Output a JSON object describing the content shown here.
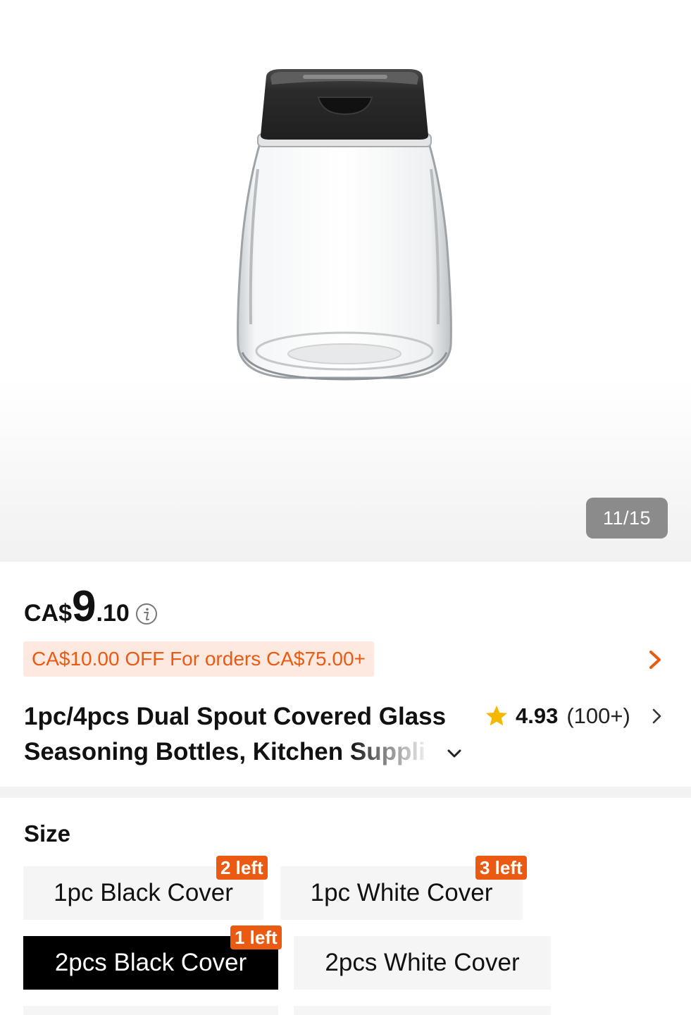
{
  "gallery": {
    "image_counter": "11/15",
    "product_image": "glass-seasoning-bottle-black-cover"
  },
  "price": {
    "currency": "CA$",
    "integer": "9",
    "decimal": ".10",
    "info_icon": "info-icon"
  },
  "promo": {
    "text": "CA$10.00 OFF For orders CA$75.00+",
    "arrow_icon": "chevron-right-icon",
    "color": "#ea5a13",
    "background": "#fde9e0"
  },
  "product": {
    "title_main": "1pc/4pcs Dual Spout Covered Glass Seasoning Bottles, Kitchen",
    "title_faded": "Suppli",
    "expand_icon": "chevron-down-icon"
  },
  "rating": {
    "star_icon": "star-icon",
    "score": "4.93",
    "count": "(100+)",
    "arrow_icon": "chevron-right-icon",
    "star_color": "#f5b800"
  },
  "size": {
    "label": "Size",
    "options": [
      {
        "label": "1pc Black Cover",
        "stock": "2 left",
        "selected": false
      },
      {
        "label": "1pc White Cover",
        "stock": "3 left",
        "selected": false
      },
      {
        "label": "2pcs Black Cover",
        "stock": "1 left",
        "selected": true
      },
      {
        "label": "2pcs White Cover",
        "stock": "",
        "selected": false
      }
    ],
    "badge_color": "#ea5a13",
    "selected_color": "#000000"
  }
}
